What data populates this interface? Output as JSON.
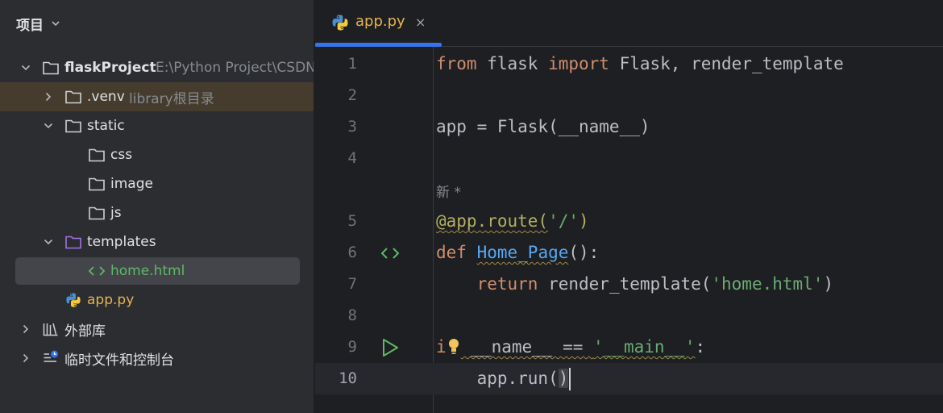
{
  "sidebar": {
    "title": "项目",
    "tree": [
      {
        "label": "flaskProject",
        "hint": "E:\\Python Project\\CSDN",
        "icon": "folder-icon"
      },
      {
        "label": ".venv",
        "hint": "library根目录",
        "icon": "folder-icon"
      },
      {
        "label": "static",
        "icon": "folder-icon"
      },
      {
        "label": "css",
        "icon": "folder-icon"
      },
      {
        "label": "image",
        "icon": "folder-icon"
      },
      {
        "label": "js",
        "icon": "folder-icon"
      },
      {
        "label": "templates",
        "icon": "folder-icon"
      },
      {
        "label": "home.html",
        "icon": "html-icon"
      },
      {
        "label": "app.py",
        "icon": "python-icon"
      },
      {
        "label": "外部库",
        "icon": "library-icon"
      },
      {
        "label": "临时文件和控制台",
        "icon": "scratches-icon"
      }
    ]
  },
  "editor": {
    "tab": {
      "label": "app.py",
      "close": "×"
    },
    "inlay_hint": "新 *",
    "line_numbers": [
      "1",
      "2",
      "3",
      "4",
      "5",
      "6",
      "7",
      "8",
      "9",
      "10"
    ],
    "code": {
      "l1": [
        "from",
        " flask ",
        "import",
        " Flask, render_template"
      ],
      "l3": "app = Flask(__name__)",
      "l5": [
        "@app.route(",
        "'/'",
        ")"
      ],
      "l6": [
        "def",
        " ",
        "Home_Page",
        "():"
      ],
      "l7": [
        "    ",
        "return",
        " render_template(",
        "'home.html'",
        ")"
      ],
      "l9": [
        "i",
        " __name__ == ",
        "'__main__'",
        ":"
      ],
      "l10": [
        "    app.run(",
        ")"
      ]
    }
  },
  "colors": {
    "accent": "#3574f0",
    "keyword": "#cf8e6d",
    "string": "#6aab73",
    "function": "#56a8f5",
    "decorator": "#b3ae60"
  }
}
